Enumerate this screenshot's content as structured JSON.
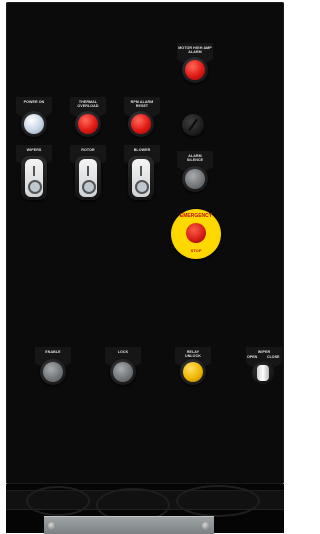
{
  "panel": {
    "labels": {
      "motor_high_amp_alarm": "MOTOR HIGH AMP\nALARM",
      "power_on": "POWER ON",
      "thermal_overload": "THERMAL\nOVERLOAD",
      "rpm_alarm_reset": "RPM ALARM\nRESET",
      "wipers": "WIPERS",
      "rotor": "ROTOR",
      "blower": "BLOWER",
      "alarm_silence": "ALARM\nSILENCE",
      "enable": "ENABLE",
      "lock": "LOCK",
      "relay_unlock": "RELAY\nUNLOCK",
      "wiper_mode": "WIPER",
      "wiper_open": "OPEN",
      "wiper_close": "CLOSE"
    },
    "emergency_stop": {
      "top_text": "EMERGENCY",
      "bottom_text": "STOP"
    }
  },
  "colors": {
    "panel": "#0b0b0c",
    "red_lamp": "#e01814",
    "clear_lamp": "#c7d4e4",
    "grey_button": "#6f7376",
    "amber_button": "#f0b600",
    "estop_ring": "#ffd800"
  },
  "icons": [
    "key-switch-icon",
    "selector-switch-icon",
    "push-pull-icon"
  ]
}
